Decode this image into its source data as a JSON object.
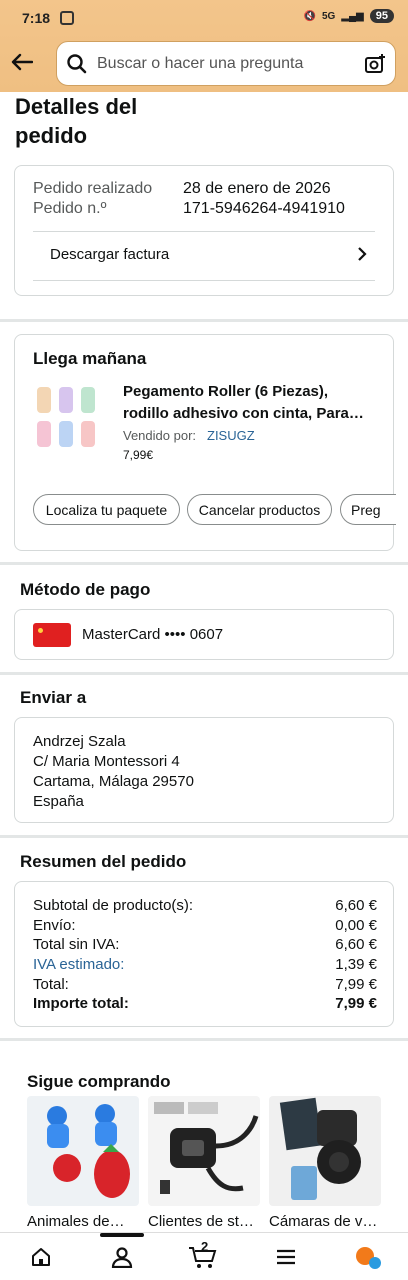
{
  "status": {
    "time": "7:18",
    "battery": "95",
    "signal": "5G"
  },
  "header": {
    "search_placeholder": "Buscar o hacer una pregunta"
  },
  "page": {
    "title": "Detalles del pedido"
  },
  "order": {
    "placed_label": "Pedido realizado",
    "placed_value": "28 de enero de 2026",
    "number_label": "Pedido n.º",
    "number_value": "171-5946264-4941910",
    "invoice_label": "Descargar factura"
  },
  "delivery": {
    "heading": "Llega mañana",
    "product_title_1": "Pegamento Roller (6 Piezas),",
    "product_title_2": "rodillo adhesivo con cinta, Para…",
    "sold_by_label": "Vendido por:",
    "seller": "ZISUGZ",
    "price": "7,99€",
    "actions": [
      "Localiza tu paquete",
      "Cancelar productos",
      "Preg"
    ]
  },
  "payment": {
    "heading": "Método de pago",
    "card": "MasterCard •••• 0607"
  },
  "shipping": {
    "heading": "Enviar a",
    "lines": [
      "Andrzej Szala",
      "C/ Maria Montessori 4",
      "Cartama, Málaga 29570",
      "España"
    ]
  },
  "summary": {
    "heading": "Resumen del pedido",
    "rows": [
      {
        "label": "Subtotal de producto(s):",
        "value": "6,60 €"
      },
      {
        "label": "Envío:",
        "value": "0,00 €"
      },
      {
        "label": "Total sin IVA:",
        "value": "6,60 €"
      },
      {
        "label": "IVA estimado:",
        "value": "1,39 €"
      },
      {
        "label": "Total:",
        "value": "7,99 €"
      },
      {
        "label": "Importe total:",
        "value": "7,99 €"
      }
    ]
  },
  "keep_shopping": {
    "heading": "Sigue comprando",
    "items": [
      "Animales de…",
      "Clientes de st…",
      "Cámaras de v…"
    ]
  },
  "bottom_nav": {
    "cart_count": "2"
  },
  "colors": {
    "header": "#f1c27f",
    "link": "#2a6496",
    "mastercard": "#e02020"
  }
}
